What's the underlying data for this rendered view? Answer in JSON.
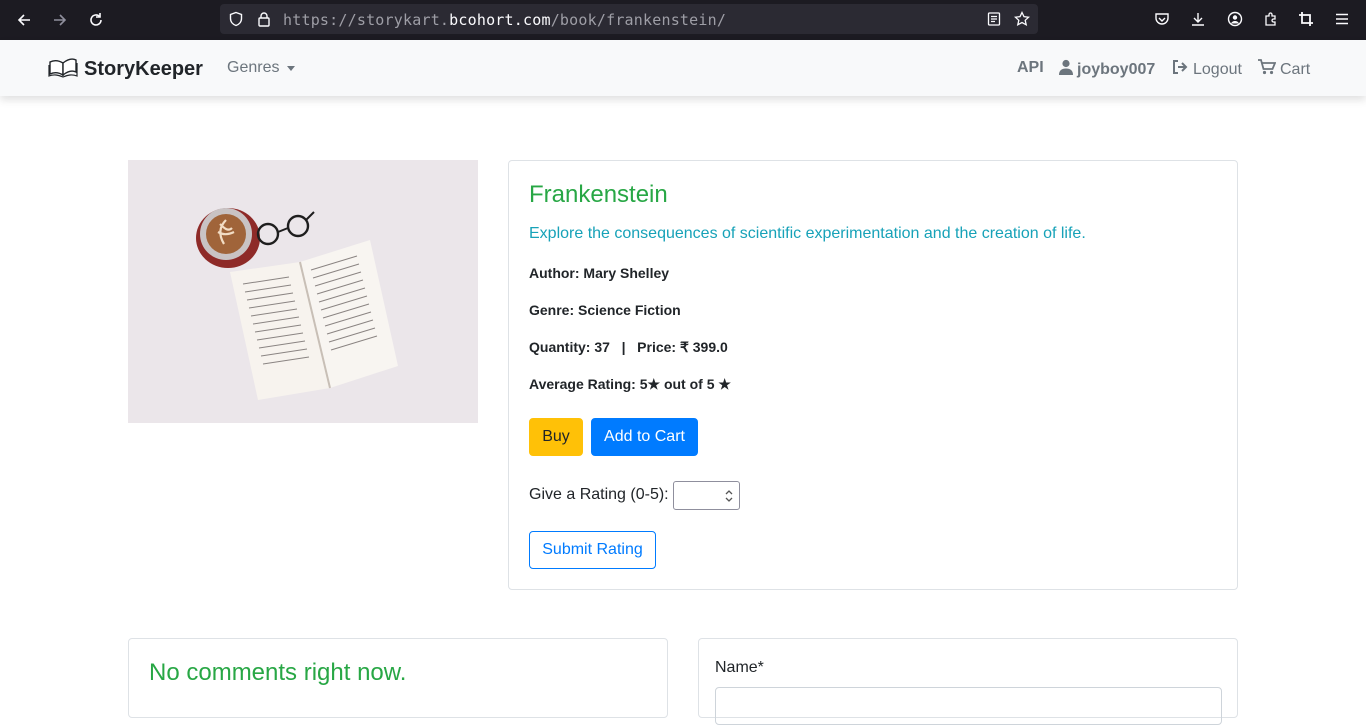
{
  "browser": {
    "url_prefix": "https://storykart.",
    "url_domain": "bcohort.com",
    "url_path": "/book/frankenstein/"
  },
  "navbar": {
    "brand": "StoryKeeper",
    "genres_label": "Genres",
    "api_label": "API",
    "username": "joyboy007",
    "logout_label": "Logout",
    "cart_label": "Cart"
  },
  "book": {
    "title": "Frankenstein",
    "description": "Explore the consequences of scientific experimentation and the creation of life.",
    "author_line": "Author: Mary Shelley",
    "genre_line": "Genre: Science Fiction",
    "quantity_line": "Quantity: 37   |   Price: ₹ 399.0",
    "rating_line": "Average Rating: 5★ out of 5 ★"
  },
  "actions": {
    "buy_label": "Buy",
    "add_to_cart_label": "Add to Cart",
    "rating_prompt": "Give a Rating (0-5):",
    "rating_value": "",
    "submit_label": "Submit Rating"
  },
  "comments": {
    "empty_text": "No comments right now."
  },
  "comment_form": {
    "name_label": "Name*"
  },
  "colors": {
    "title_green": "#28a745",
    "info_teal": "#17a2b8",
    "buy_yellow": "#ffc107",
    "primary_blue": "#007bff"
  }
}
